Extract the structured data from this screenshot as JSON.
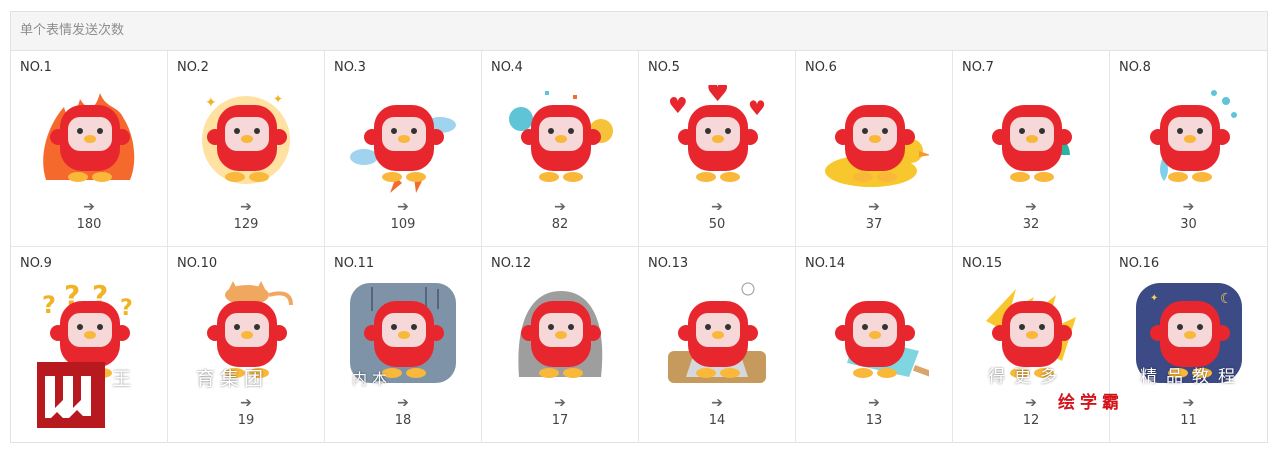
{
  "panel": {
    "title": "单个表情发送次数"
  },
  "stickers": [
    {
      "no": "NO.1",
      "arrow": "➔",
      "count": "180",
      "icon": "mascot-on-fire-icon"
    },
    {
      "no": "NO.2",
      "arrow": "➔",
      "count": "129",
      "icon": "mascot-happy-sunburst-icon"
    },
    {
      "no": "NO.3",
      "arrow": "➔",
      "count": "109",
      "icon": "mascot-rocket-flying-icon"
    },
    {
      "no": "NO.4",
      "arrow": "➔",
      "count": "82",
      "icon": "mascot-cheering-pompoms-icon"
    },
    {
      "no": "NO.5",
      "arrow": "➔",
      "count": "50",
      "icon": "mascot-hearts-icon"
    },
    {
      "no": "NO.6",
      "arrow": "➔",
      "count": "37",
      "icon": "mascot-duck-float-icon"
    },
    {
      "no": "NO.7",
      "arrow": "➔",
      "count": "32",
      "icon": "mascot-fan-icon"
    },
    {
      "no": "NO.8",
      "arrow": "➔",
      "count": "30",
      "icon": "mascot-crying-icon"
    },
    {
      "no": "NO.9",
      "arrow": "➔",
      "count": "",
      "icon": "mascot-confused-question-icon"
    },
    {
      "no": "NO.10",
      "arrow": "➔",
      "count": "19",
      "icon": "mascot-cat-on-head-icon"
    },
    {
      "no": "NO.11",
      "arrow": "➔",
      "count": "18",
      "icon": "mascot-gloomy-rain-icon"
    },
    {
      "no": "NO.12",
      "arrow": "➔",
      "count": "17",
      "icon": "mascot-ghost-icon"
    },
    {
      "no": "NO.13",
      "arrow": "➔",
      "count": "14",
      "icon": "mascot-laptop-icon"
    },
    {
      "no": "NO.14",
      "arrow": "➔",
      "count": "13",
      "icon": "mascot-popsicle-icon"
    },
    {
      "no": "NO.15",
      "arrow": "➔",
      "count": "12",
      "icon": "mascot-angry-drink-icon"
    },
    {
      "no": "NO.16",
      "arrow": "➔",
      "count": "11",
      "icon": "mascot-night-wine-icon"
    }
  ],
  "watermark": {
    "text1": "王",
    "text2": "育集团",
    "text3": "内本",
    "text4": "得更多",
    "text5": "精品教程",
    "brand": "绘学霸"
  },
  "colors": {
    "mascot_red": "#e8262e",
    "face": "#f7d8d8",
    "beak": "#f9b83a",
    "watermark_red": "#b8191e"
  }
}
